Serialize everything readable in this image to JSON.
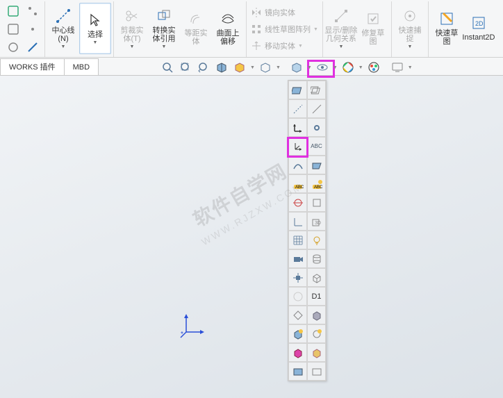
{
  "ribbon": {
    "groups": [
      {
        "items": [
          {
            "type": "tiny-col"
          }
        ]
      },
      {
        "items": [
          {
            "label": "中心线\n(N)",
            "name": "centerline",
            "icon": "line",
            "dd": true
          },
          {
            "label": "选择",
            "name": "select",
            "icon": "cursor",
            "sel": true,
            "dd": true
          }
        ]
      },
      {
        "items": [
          {
            "label": "剪裁实\n体(T)",
            "name": "trim",
            "icon": "scissors",
            "dis": true,
            "dd": true
          },
          {
            "label": "转换实\n体引用",
            "name": "convert",
            "icon": "convert",
            "dd": true
          },
          {
            "label": "等距实\n体",
            "name": "offset",
            "icon": "offset",
            "dis": true
          },
          {
            "label": "曲面上\n偏移",
            "name": "surface-offset",
            "icon": "surf"
          }
        ]
      },
      {
        "small": [
          {
            "label": "镜向实体",
            "name": "mirror",
            "icon": "mirror"
          },
          {
            "label": "线性草图阵列",
            "name": "linear-pattern",
            "icon": "pattern",
            "dd": true
          },
          {
            "label": "移动实体",
            "name": "move",
            "icon": "move",
            "dd": true
          }
        ]
      },
      {
        "items": [
          {
            "label": "显示/删除\n几何关系",
            "name": "relations",
            "icon": "rel",
            "dis": true,
            "dd": true
          },
          {
            "label": "修复草\n图",
            "name": "repair",
            "icon": "repair",
            "dis": true
          }
        ]
      },
      {
        "items": [
          {
            "label": "快速捕\n捉",
            "name": "snap",
            "icon": "snap",
            "dis": true,
            "dd": true
          }
        ]
      },
      {
        "items": [
          {
            "label": "快速草\n图",
            "name": "quick-sketch",
            "icon": "qsketch"
          },
          {
            "label": "Instant2D",
            "name": "instant2d",
            "icon": "i2d"
          }
        ]
      }
    ]
  },
  "tabs": [
    {
      "label": "WORKS 插件",
      "name": "tab-works"
    },
    {
      "label": "MBD",
      "name": "tab-mbd"
    }
  ],
  "toolrow": [
    {
      "name": "zoom-fit",
      "icon": "mag-fit"
    },
    {
      "name": "zoom-area",
      "icon": "mag-area"
    },
    {
      "name": "zoom-prev",
      "icon": "mag-prev"
    },
    {
      "name": "section",
      "icon": "section-cube"
    },
    {
      "name": "view-orient",
      "icon": "view-or",
      "dd": true
    },
    {
      "name": "display-style",
      "icon": "disp",
      "dd": true
    },
    {
      "name": "sep"
    },
    {
      "name": "item-vis",
      "icon": "box",
      "dd": true
    },
    {
      "name": "hide-show",
      "icon": "eye",
      "dd": true,
      "hl": true
    },
    {
      "name": "appearance",
      "icon": "appear",
      "dd": true
    },
    {
      "name": "scene",
      "icon": "scene"
    },
    {
      "name": "sep"
    },
    {
      "name": "view-settings",
      "icon": "monitor",
      "dd": true
    }
  ],
  "panel": {
    "rows": [
      [
        "plane",
        "planes"
      ],
      [
        "axis-l",
        "axis-r"
      ],
      [
        "origin",
        "pt"
      ],
      [
        "csys",
        "csys2"
      ],
      [
        "curve",
        "surf2"
      ],
      [
        "annot",
        "annot2"
      ],
      [
        "sketch-ic",
        "box2"
      ],
      [
        "dim",
        "3d"
      ],
      [
        "grid",
        "bulb"
      ],
      [
        "cam",
        "cyl"
      ],
      [
        "ctr",
        "cube3"
      ],
      [
        "blank",
        "D1"
      ],
      [
        "diamond",
        "solid"
      ],
      [
        "wire1",
        "wire2"
      ],
      [
        "shad1",
        "shad2"
      ],
      [
        "last1",
        "last2"
      ]
    ]
  },
  "watermark": "软件自学网",
  "watermark2": "WWW.RJZXW.COM"
}
